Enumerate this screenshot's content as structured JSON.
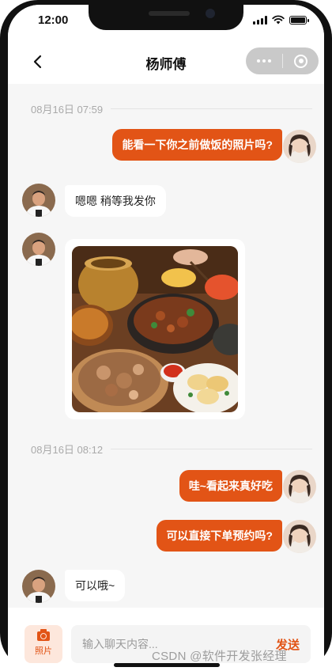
{
  "status_bar": {
    "time": "12:00"
  },
  "nav": {
    "title": "杨师傅"
  },
  "messages": {
    "time1": "08月16日 07:59",
    "m1": "能看一下你之前做饭的照片吗?",
    "m2": "嗯嗯 稍等我发你",
    "time2": "08月16日 08:12",
    "m3": "哇~看起来真好吃",
    "m4": "可以直接下单预约吗?",
    "m5": "可以哦~"
  },
  "input_bar": {
    "photo_label": "照片",
    "placeholder": "输入聊天内容...",
    "send_label": "发送"
  },
  "watermark": "CSDN @软件开发张经理",
  "colors": {
    "accent": "#e25416",
    "accent_soft": "#fde7dc",
    "background": "#f6f6f6"
  },
  "icons": [
    "back-arrow-icon",
    "more-dots-icon",
    "close-circle-icon",
    "camera-icon",
    "signal-icon",
    "wifi-icon",
    "battery-icon"
  ]
}
